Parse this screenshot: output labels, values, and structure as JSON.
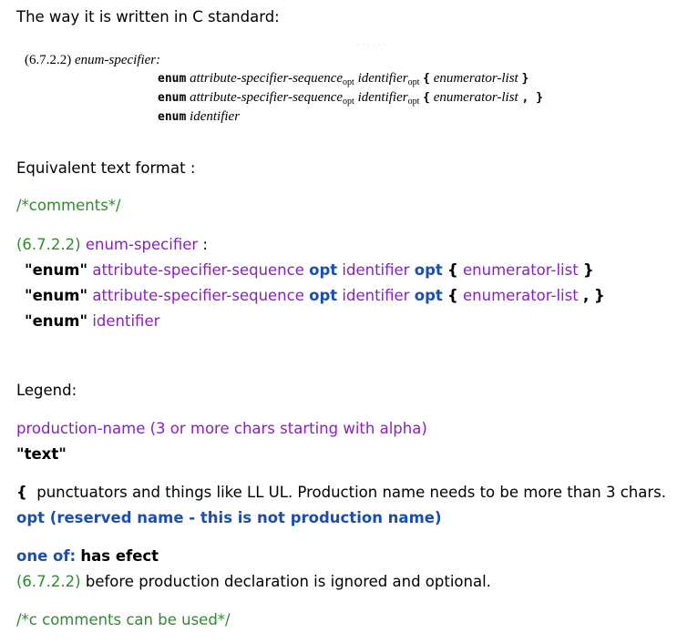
{
  "intro": "The way it is written in C standard:",
  "standard": {
    "ref": "(6.7.2.2)",
    "name": "enum-specifier:",
    "lines": [
      {
        "kw": "enum",
        "a": "attribute-specifier-sequence",
        "o1": "opt",
        "b": "identifier",
        "o2": "opt",
        "open": "{",
        "c": "enumerator-list",
        "tail": "}"
      },
      {
        "kw": "enum",
        "a": "attribute-specifier-sequence",
        "o1": "opt",
        "b": "identifier",
        "o2": "opt",
        "open": "{",
        "c": "enumerator-list",
        "tail": ", }"
      },
      {
        "kw": "enum",
        "b": "identifier"
      }
    ]
  },
  "equivalent": "Equivalent text format :",
  "comment1": "/*comments*/",
  "text_format": {
    "ref": "(6.7.2.2)",
    "name": "enum-specifier",
    "colon": ":",
    "lines": [
      {
        "kw": "\"enum\"",
        "a": "attribute-specifier-sequence",
        "o1": "opt",
        "b": "identifier",
        "o2": "opt",
        "open": "{",
        "c": "enumerator-list",
        "tail": "}"
      },
      {
        "kw": "\"enum\"",
        "a": "attribute-specifier-sequence",
        "o1": "opt",
        "b": "identifier",
        "o2": "opt",
        "open": "{",
        "c": "enumerator-list",
        "tail": ", }"
      },
      {
        "kw": "\"enum\"",
        "b": "identifier"
      }
    ]
  },
  "legend": {
    "title": "Legend:",
    "production": "production-name (3 or more chars starting with alpha)",
    "text": "\"text\"",
    "punct_brace": "{",
    "punct_text": "punctuators and things like LL UL. Production name needs to be more than 3 chars.",
    "opt": "opt (reserved name - this is not production name)",
    "oneof": "one of:",
    "oneof_text": "has efect",
    "ref": "(6.7.2.2)",
    "ref_text": "before production declaration is ignored and optional.",
    "comment": "/*c comments can be used*/"
  },
  "colors": {
    "green": "#2e8b2e",
    "purple": "#8a1fc2",
    "blue": "#1a4fb0"
  }
}
